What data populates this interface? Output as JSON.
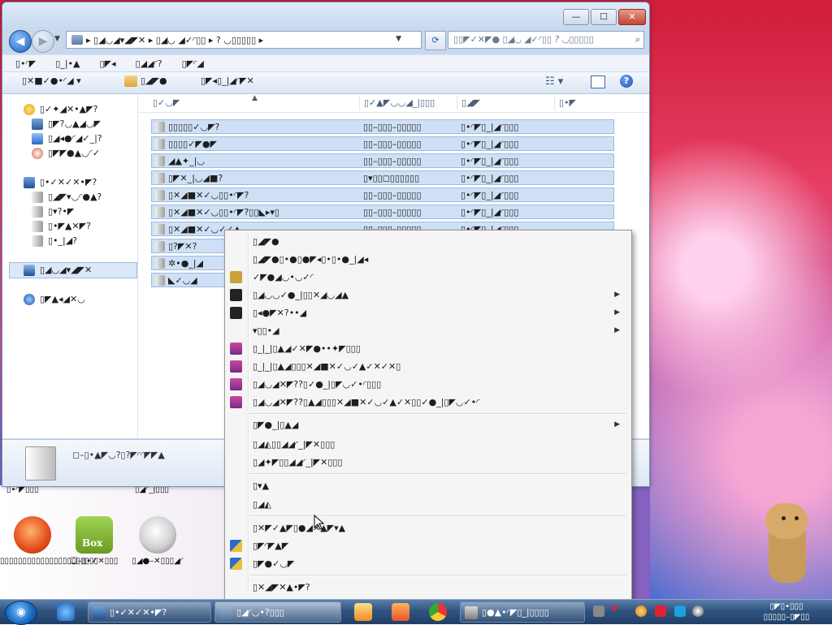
{
  "window": {
    "title_buttons": {
      "minimize": "—",
      "maximize": "☐",
      "close": "✕"
    },
    "address": "▸ ▯◢◡◢▾◢◤✕ ▸ ▯◢◡ ◢✓◜▯▯ ▸ ? ◡▯▯▯▯▯ ▸",
    "search_placeholder": "▯▯◤✓✕◤● ▯◢◡ ◢✓◜▯▯ ? ◡▯▯▯▯▯",
    "menu": [
      "▯•◜◤",
      "▯_|•▲",
      "▯◤◂",
      "▯◢◢◜?",
      "▯◤◜◢"
    ],
    "toolbar": {
      "organize": "▯✕■✓●•◜◢ ▾",
      "share": "▯◢◤●",
      "new": "▯◤◂▯_|◢◜◤✕"
    }
  },
  "navpane": {
    "favorites": [
      {
        "label": "▯✓✦◢✕•▲◤?"
      },
      {
        "label": "▯◤?◡▲◢◡◤"
      },
      {
        "label": "▯◢◂●◜◢✓_|?"
      },
      {
        "label": "▯◤◤●▲◡◜✓"
      }
    ],
    "libraries_title": "▯•✓✕✓✕•◤?",
    "libraries": [
      {
        "label": "▯◢◤▾◡◜●▲?"
      },
      {
        "label": "▯▾?•◤"
      },
      {
        "label": "▯•◤▲✕◤?"
      },
      {
        "label": "▯•_|◢?"
      }
    ],
    "computer": "▯◢◡◢▾◢◤✕",
    "network": "▯◤▲◂◢✕◡"
  },
  "columns": {
    "name": "▯✓◡◤",
    "date": "▯✓▲◤◡◡◢_|▯▯▯",
    "type": "▯◢◤",
    "size": "▯•◤"
  },
  "rows": [
    {
      "name": "▯▯▯▯▯✓◡◤?",
      "date": "▯▯–▯▯▯–▯▯▯▯▯",
      "type": "▯•◜◤▯_|◢◜▯▯▯"
    },
    {
      "name": "▯▯▯▯✓◤●◤",
      "date": "▯▯–▯▯▯–▯▯▯▯▯",
      "type": "▯•◜◤▯_|◢◜▯▯▯"
    },
    {
      "name": "◢▲✦_|◡",
      "date": "▯▯–▯▯▯–▯▯▯▯▯",
      "type": "▯•◜◤▯_|◢◜▯▯▯"
    },
    {
      "name": "▯◤✕_|◡◢■?",
      "date": "▯▾▯▯◻▯▯▯▯▯▯",
      "type": "▯•◜◤▯_|◢◜▯▯▯"
    },
    {
      "name": "▯✕◢■✕✓◡▯▯•◜◤?",
      "date": "▯▯–▯▯▯–▯▯▯▯▯",
      "type": "▯•◜◤▯_|◢◜▯▯▯"
    },
    {
      "name": "▯✕◢■✕✓◡▯▯•◜◤?▯▯◣▸▾▯",
      "date": "▯▯–▯▯▯–▯▯▯▯▯",
      "type": "▯•◜◤▯_|◢◜▯▯▯"
    },
    {
      "name": "▯✕◢■✕✓◡✓✓▲",
      "date": "▯▯–▯▯▯–▯▯▯▯▯",
      "type": "▯•◜◤▯_|◢◜▯▯▯"
    },
    {
      "name": "▯?◤✕?",
      "date": "▯▯–▯▯▯–▯▯▯▯▯",
      "type": "▯•◜◤▯_|◢◜▯▯▯"
    },
    {
      "name": "✲•●_|◢",
      "date": "▯▯–▯▯▯–▯▯▯▯▯",
      "type": "▯•◜◤▯_|◢◜▯▯▯"
    },
    {
      "name": "◣✓◡◢",
      "date": "▯▯–▯▯▯–▯▯▯▯▯",
      "type": "▯•◜◤▯_|◢◜▯▯▯"
    }
  ],
  "details_text": "◻–▯•▲◤◡?▯?◤◜◜◤◤▲",
  "context_menu": [
    {
      "label": "▯◢◤●",
      "arrow": "",
      "icon": "",
      "color": ""
    },
    {
      "label": "▯◢◤●▯•●▯●◤◂▯•▯•●_|◢◂",
      "arrow": "",
      "icon": "",
      "color": ""
    },
    {
      "label": "✓◤●◢◡•◡✓◜",
      "arrow": "",
      "icon": "app-icon",
      "color": "#c9a23a"
    },
    {
      "label": "▯◢◡◡✓●_|▯▯✕◢◡◢▲",
      "arrow": "▶",
      "icon": "cmd-icon",
      "color": "#222222"
    },
    {
      "label": "▯◂●◤✕?••◢",
      "arrow": "▶",
      "icon": "cmd-icon",
      "color": "#222222"
    },
    {
      "label": "▾▯▯•◢",
      "arrow": "▶",
      "icon": "",
      "color": ""
    },
    {
      "label": "▯_|_|▯▲◢✓✕◤●••✦◤▯▯▯",
      "arrow": "",
      "icon": "rar-icon",
      "color": "#7a2a8a"
    },
    {
      "label": "▯_|_|▯▲◢▯▯▯✕◢■✕✓◡✓▲✓✕✓✕▯",
      "arrow": "",
      "icon": "rar-icon",
      "color": "#7a2a8a"
    },
    {
      "label": "▯◢◡◢✕◤??▯✓●_|▯◤◡✓•◜▯▯▯",
      "arrow": "",
      "icon": "rar-icon",
      "color": "#7a2a8a"
    },
    {
      "label": "▯◢◡◢✕◤??▯▲◢▯▯▯✕◢■✕✓◡✓▲✓✕▯▯✓●_|▯◤◡✓•◜",
      "arrow": "",
      "icon": "rar-icon",
      "color": "#7a2a8a"
    },
    {
      "label": "▯◤●_|▯▲◢",
      "arrow": "▶",
      "icon": "",
      "color": ""
    },
    {
      "label": "▯◢◭▯▯◢◢◜_|◤✕▯▯▯",
      "arrow": "",
      "icon": "",
      "color": ""
    },
    {
      "label": "▯◢✦◤▯▯◢◢◜_|◤✕▯▯▯",
      "arrow": "",
      "icon": "",
      "color": ""
    },
    {
      "label": "▯▾▲",
      "arrow": "",
      "icon": "",
      "color": ""
    },
    {
      "label": "▯◢◭",
      "arrow": "",
      "icon": "",
      "color": ""
    },
    {
      "label": "▯✕◤✓▲◤▯●◢✕▲◤▾▲",
      "arrow": "",
      "icon": "",
      "color": ""
    },
    {
      "label": "▯◤◜◤▲◤",
      "arrow": "",
      "icon": "shield-icon",
      "color": "#2d6bd1"
    },
    {
      "label": "▯◤●✓◡◤",
      "arrow": "",
      "icon": "shield-icon",
      "color": "#2d6bd1"
    },
    {
      "label": "▯✕◢◤✕▲•◤?",
      "arrow": "",
      "icon": "",
      "color": ""
    }
  ],
  "desktop": {
    "top_labels": [
      "▯•◜◤▯▯▯",
      "▯◢◜_|▯▯▯"
    ],
    "icons": [
      {
        "label": "▯▯▯▯▯▯▯▯▯▯▯▯▯▯▯▯▯▯▯▯▯▯",
        "color": "#e24c1c",
        "badge": ""
      },
      {
        "label": "❑–▯•✓✕▯▯▯",
        "color": "#7cae2f",
        "badge": "Box"
      },
      {
        "label": "▯◢●–✕▯▯▯◢◜",
        "color": "#d9d9d9",
        "badge": ""
      }
    ]
  },
  "taskbar": {
    "start": "◉",
    "tasks": [
      {
        "label": "▯•✓✕✓✕•◤?"
      },
      {
        "label": "▯◢◜◡•?▯▯▯"
      },
      {
        "label": "▯●▲•◜◤▯_|▯▯▯▯"
      }
    ],
    "clock": {
      "time": "▯◤▯•▯▯▯",
      "date": "▯▯▯▯▯–▯◤▯▯"
    }
  }
}
